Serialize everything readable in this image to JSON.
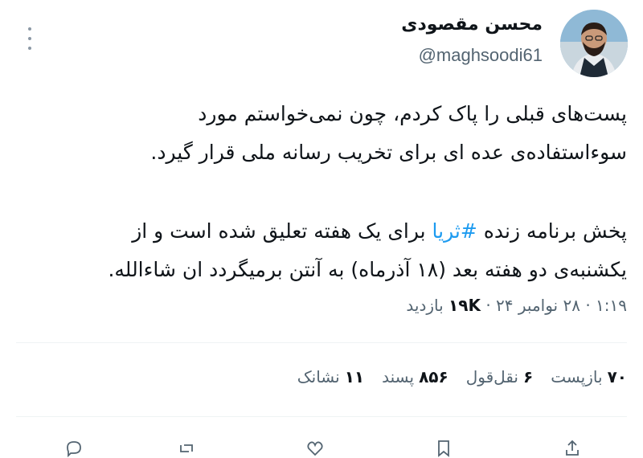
{
  "author": {
    "name": "محسن مقصودی",
    "handle": "@maghsoodi61"
  },
  "tweet": {
    "paragraph1_line1": "پست‌های قبلی را پاک کردم، چون نمی‌خواستم مورد",
    "paragraph1_line2": "سوءاستفاده‌ی عده ای برای تخریب رسانه ملی قرار گیرد.",
    "paragraph2_line1_before": "پخش برنامه زنده ",
    "hashtag": "#ثریا",
    "paragraph2_line1_after": " برای یک هفته تعلیق شده است و از",
    "paragraph2_line2": "یکشنبه‌ی دو هفته بعد (۱۸ آذرماه) به آنتن برمیگردد ان شاءالله."
  },
  "meta": {
    "time": "۱:۱۹",
    "date": "۲۸ نوامبر ۲۴",
    "views_count": "۱۹K",
    "views_label": "بازدید",
    "separator": "·"
  },
  "stats": {
    "retweets_count": "۷۰",
    "retweets_label": "بازپست",
    "quotes_count": "۶",
    "quotes_label": "نقل‌قول",
    "likes_count": "۸۵۶",
    "likes_label": "پسند",
    "bookmarks_count": "۱۱",
    "bookmarks_label": "نشانک"
  },
  "colors": {
    "accent": "#1d9bf0",
    "secondary_text": "#536471",
    "divider": "#eff3f4"
  },
  "icons": [
    "more-icon",
    "reply-icon",
    "retweet-icon",
    "like-icon",
    "bookmark-icon",
    "share-icon"
  ]
}
